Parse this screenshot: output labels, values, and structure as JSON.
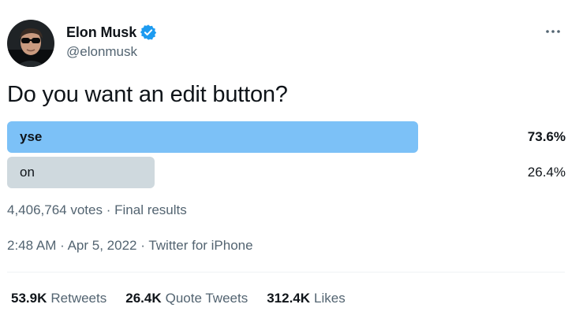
{
  "colors": {
    "accent": "#1d9bf0",
    "winner_bar": "#7cc1f7",
    "loser_bar": "#cfd9de",
    "secondary_text": "#536471"
  },
  "author": {
    "name": "Elon Musk",
    "handle": "@elonmusk",
    "verified": true,
    "avatar_icon": "profile-photo"
  },
  "more_icon": "more-horizontal-icon",
  "tweet": {
    "text": "Do you want an edit button?"
  },
  "poll": {
    "options": [
      {
        "label": "yse",
        "percent_text": "73.6%",
        "percent": 73.6,
        "winner": true
      },
      {
        "label": "on",
        "percent_text": "26.4%",
        "percent": 26.4,
        "winner": false
      }
    ],
    "votes_text": "4,406,764 votes",
    "separator": "·",
    "status": "Final results"
  },
  "meta": {
    "time": "2:48 AM",
    "separator": "·",
    "date": "Apr 5, 2022",
    "source": "Twitter for iPhone"
  },
  "stats": [
    {
      "count": "53.9K",
      "label": "Retweets"
    },
    {
      "count": "26.4K",
      "label": "Quote Tweets"
    },
    {
      "count": "312.4K",
      "label": "Likes"
    }
  ]
}
